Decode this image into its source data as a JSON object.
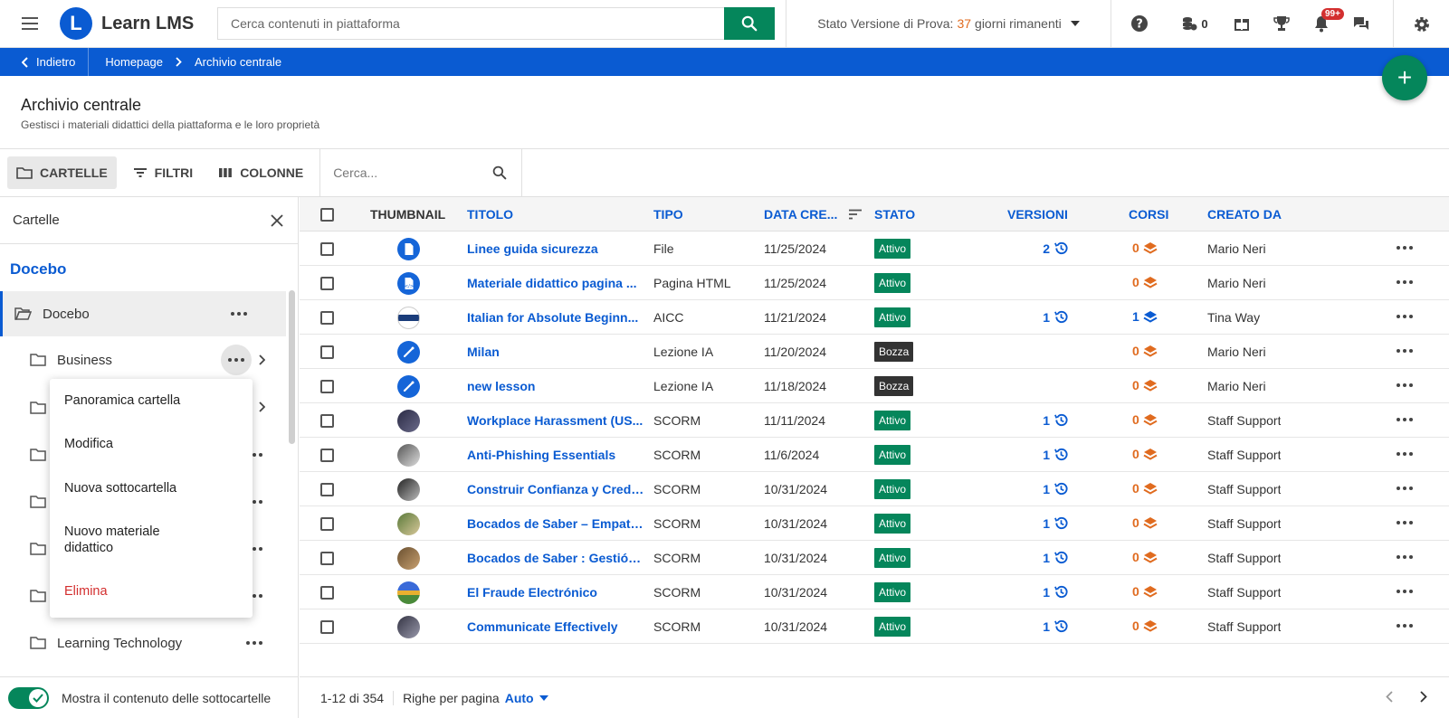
{
  "app": {
    "name": "Learn LMS",
    "logo_letter": "L"
  },
  "search": {
    "placeholder": "Cerca contenuti in piattaforma"
  },
  "trial": {
    "label": "Stato Versione di Prova:",
    "days": "37",
    "suffix": "giorni rimanenti"
  },
  "header_icons": {
    "coins_count": "0",
    "notifications_badge": "99+"
  },
  "breadcrumb": {
    "back": "Indietro",
    "home": "Homepage",
    "current": "Archivio centrale"
  },
  "page": {
    "title": "Archivio centrale",
    "subtitle": "Gestisci i materiali didattici della piattaforma e le loro proprietà"
  },
  "toolbar": {
    "folders": "CARTELLE",
    "filters": "FILTRI",
    "columns": "COLONNE",
    "search_placeholder": "Cerca..."
  },
  "left_panel": {
    "title": "Cartelle",
    "root": "Docebo",
    "selected_folder": "Docebo",
    "folders": [
      "Business",
      "Learning Technology"
    ],
    "show_subfolders": "Mostra il contenuto delle sottocartelle"
  },
  "context_menu": {
    "items": [
      "Panoramica cartella",
      "Modifica",
      "Nuova sottocartella",
      "Nuovo materiale didattico",
      "Elimina"
    ]
  },
  "table": {
    "headers": {
      "thumbnail": "THUMBNAIL",
      "title": "TITOLO",
      "type": "TIPO",
      "date": "DATA CRE...",
      "status": "STATO",
      "versions": "VERSIONI",
      "courses": "CORSI",
      "creator": "CREATO DA"
    },
    "rows": [
      {
        "title": "Linee guida sicurezza",
        "type": "File",
        "date": "11/25/2024",
        "status": "Attivo",
        "versions": "2",
        "courses": "0",
        "creator": "Mario Neri"
      },
      {
        "title": "Materiale didattico pagina ...",
        "type": "Pagina HTML",
        "date": "11/25/2024",
        "status": "Attivo",
        "versions": "",
        "courses": "0",
        "creator": "Mario Neri"
      },
      {
        "title": "Italian for Absolute Beginn...",
        "type": "AICC",
        "date": "11/21/2024",
        "status": "Attivo",
        "versions": "1",
        "courses": "1",
        "creator": "Tina Way"
      },
      {
        "title": "Milan",
        "type": "Lezione IA",
        "date": "11/20/2024",
        "status": "Bozza",
        "versions": "",
        "courses": "0",
        "creator": "Mario Neri"
      },
      {
        "title": "new lesson",
        "type": "Lezione IA",
        "date": "11/18/2024",
        "status": "Bozza",
        "versions": "",
        "courses": "0",
        "creator": "Mario Neri"
      },
      {
        "title": "Workplace Harassment (US...",
        "type": "SCORM",
        "date": "11/11/2024",
        "status": "Attivo",
        "versions": "1",
        "courses": "0",
        "creator": "Staff Support"
      },
      {
        "title": "Anti-Phishing Essentials",
        "type": "SCORM",
        "date": "11/6/2024",
        "status": "Attivo",
        "versions": "1",
        "courses": "0",
        "creator": "Staff Support"
      },
      {
        "title": "Construir Confianza y Credi...",
        "type": "SCORM",
        "date": "10/31/2024",
        "status": "Attivo",
        "versions": "1",
        "courses": "0",
        "creator": "Staff Support"
      },
      {
        "title": "Bocados de Saber – Empati...",
        "type": "SCORM",
        "date": "10/31/2024",
        "status": "Attivo",
        "versions": "1",
        "courses": "0",
        "creator": "Staff Support"
      },
      {
        "title": "Bocados de Saber : Gestión ...",
        "type": "SCORM",
        "date": "10/31/2024",
        "status": "Attivo",
        "versions": "1",
        "courses": "0",
        "creator": "Staff Support"
      },
      {
        "title": "El Fraude Electrónico",
        "type": "SCORM",
        "date": "10/31/2024",
        "status": "Attivo",
        "versions": "1",
        "courses": "0",
        "creator": "Staff Support"
      },
      {
        "title": "Communicate Effectively",
        "type": "SCORM",
        "date": "10/31/2024",
        "status": "Attivo",
        "versions": "1",
        "courses": "0",
        "creator": "Staff Support"
      }
    ]
  },
  "footer": {
    "range": "1-12 di 354",
    "rows_per_page": "Righe per pagina",
    "rows_value": "Auto"
  },
  "colors": {
    "brand_blue": "#0a5bd2",
    "accent_green": "#05865b",
    "orange": "#e06b1f",
    "danger": "#d32f2f"
  }
}
